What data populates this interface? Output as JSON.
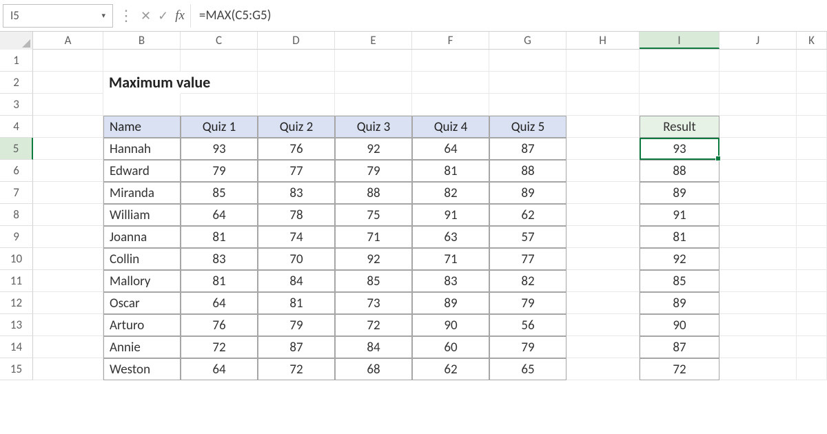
{
  "name_box": "I5",
  "formula": "=MAX(C5:G5)",
  "columns": [
    "A",
    "B",
    "C",
    "D",
    "E",
    "F",
    "G",
    "H",
    "I",
    "J",
    "K"
  ],
  "active_col": "I",
  "rows": [
    1,
    2,
    3,
    4,
    5,
    6,
    7,
    8,
    9,
    10,
    11,
    12,
    13,
    14,
    15
  ],
  "active_row": 5,
  "title": "Maximum value",
  "headers": {
    "name": "Name",
    "q1": "Quiz 1",
    "q2": "Quiz 2",
    "q3": "Quiz 3",
    "q4": "Quiz 4",
    "q5": "Quiz 5",
    "result": "Result"
  },
  "data": [
    {
      "name": "Hannah",
      "q1": "93",
      "q2": "76",
      "q3": "92",
      "q4": "64",
      "q5": "87",
      "result": "93"
    },
    {
      "name": "Edward",
      "q1": "79",
      "q2": "77",
      "q3": "79",
      "q4": "81",
      "q5": "88",
      "result": "88"
    },
    {
      "name": "Miranda",
      "q1": "85",
      "q2": "83",
      "q3": "88",
      "q4": "82",
      "q5": "89",
      "result": "89"
    },
    {
      "name": "William",
      "q1": "64",
      "q2": "78",
      "q3": "75",
      "q4": "91",
      "q5": "62",
      "result": "91"
    },
    {
      "name": "Joanna",
      "q1": "81",
      "q2": "74",
      "q3": "71",
      "q4": "63",
      "q5": "57",
      "result": "81"
    },
    {
      "name": "Collin",
      "q1": "83",
      "q2": "70",
      "q3": "92",
      "q4": "71",
      "q5": "77",
      "result": "92"
    },
    {
      "name": "Mallory",
      "q1": "81",
      "q2": "84",
      "q3": "85",
      "q4": "83",
      "q5": "82",
      "result": "85"
    },
    {
      "name": "Oscar",
      "q1": "64",
      "q2": "81",
      "q3": "73",
      "q4": "89",
      "q5": "79",
      "result": "89"
    },
    {
      "name": "Arturo",
      "q1": "76",
      "q2": "79",
      "q3": "72",
      "q4": "90",
      "q5": "56",
      "result": "90"
    },
    {
      "name": "Annie",
      "q1": "72",
      "q2": "87",
      "q3": "84",
      "q4": "60",
      "q5": "79",
      "result": "87"
    },
    {
      "name": "Weston",
      "q1": "64",
      "q2": "72",
      "q3": "68",
      "q4": "62",
      "q5": "65",
      "result": "72"
    }
  ]
}
